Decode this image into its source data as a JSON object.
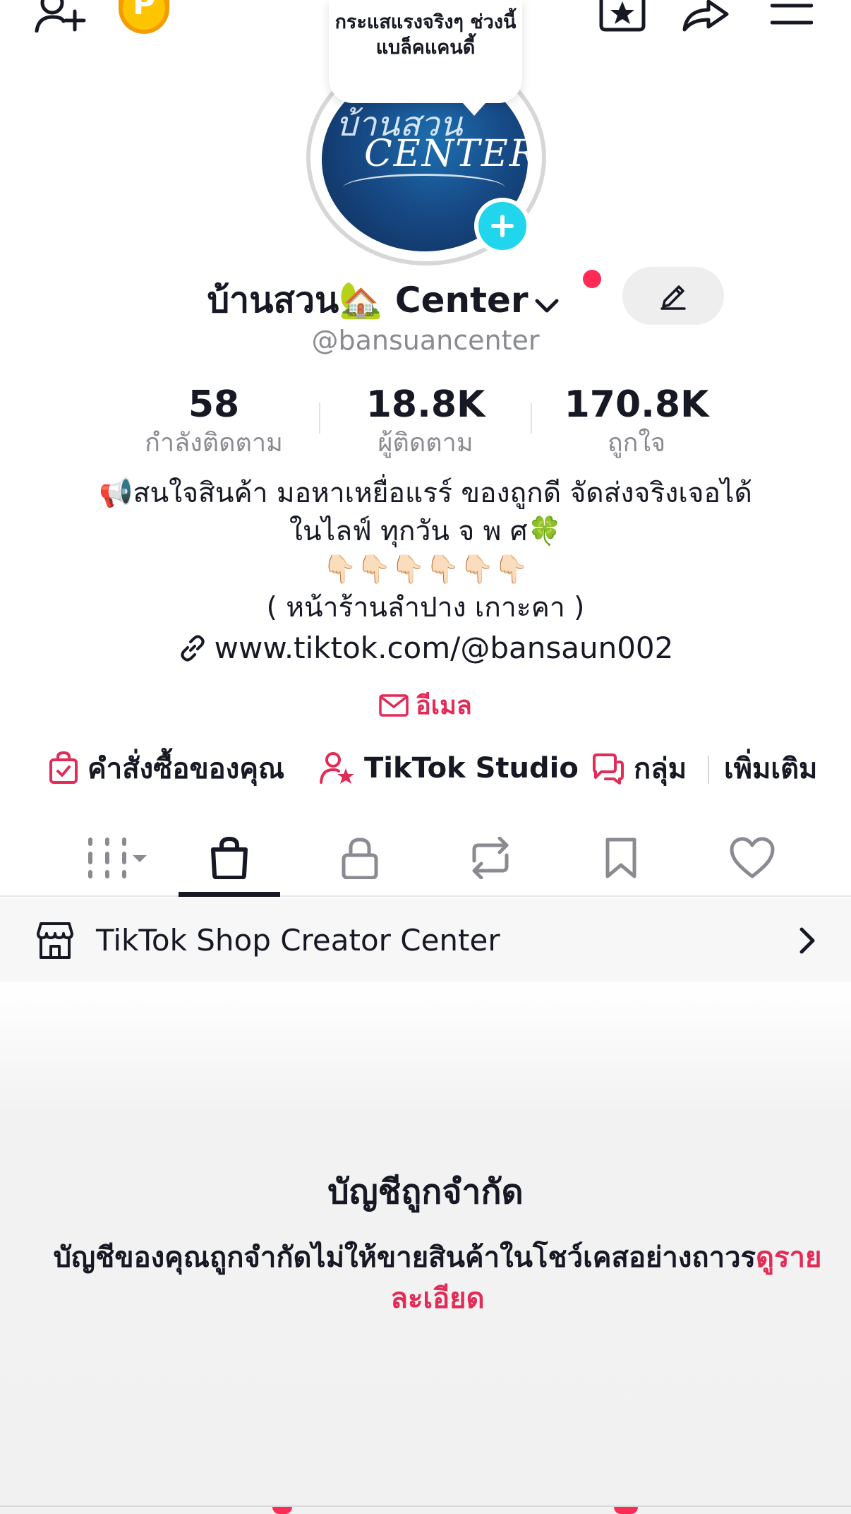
{
  "top_bar": {
    "add_friend_icon": "person-plus-icon",
    "coin_letter": "P",
    "favorites_icon": "star-card-icon",
    "share_icon": "share-arrow-icon",
    "menu_icon": "hamburger-menu-icon"
  },
  "bubble_text": "กระแสแรงจริงๆ ช่วงนี้ แบล็คแคนดี้",
  "avatar": {
    "line1": "บ้านสวน",
    "line2": "CENTER"
  },
  "profile": {
    "name": "บ้านสวน🏡 Center",
    "handle": "@bansuancenter"
  },
  "stats": [
    {
      "value": "58",
      "label": "กำลังติดตาม"
    },
    {
      "value": "18.8K",
      "label": "ผู้ติดตาม"
    },
    {
      "value": "170.8K",
      "label": "ถูกใจ"
    }
  ],
  "bio": {
    "line1": "📢สนใจสินค้า มอหาเหยื่อแรร์ ของถูกดี จัดส่งจริงเจอได้",
    "line2": "ในไลฟ์ ทุกวัน จ พ ศ🍀",
    "line3": "👇🏻👇🏻👇🏻👇🏻👇🏻👇🏻",
    "line4": "( หน้าร้านลำปาง เกาะคา )",
    "link": "www.tiktok.com/@bansaun002"
  },
  "email_label": "อีเมล",
  "shortcuts": {
    "orders": "คำสั่งซื้อของคุณ",
    "studio": "TikTok Studio",
    "group": "กลุ่ม",
    "more": "เพิ่มเติม"
  },
  "tabs": [
    "grid-icon",
    "shopping-bag-icon",
    "lock-icon",
    "repost-icon",
    "bookmark-icon",
    "heart-icon"
  ],
  "creator_center": {
    "label": "TikTok Shop Creator Center"
  },
  "restricted": {
    "title": "บัญชีถูกจำกัด",
    "description": "บัญชีของคุณถูกจำกัดไม่ให้ขายสินค้าในโชว์เคสอย่างถาวร",
    "more_link": "ดูรายละเอียด"
  },
  "colors": {
    "accent_red": "#e22b57",
    "notification_red": "#fe2c55",
    "plus_cyan": "#20d5ec",
    "muted_text": "#8a8b91"
  }
}
